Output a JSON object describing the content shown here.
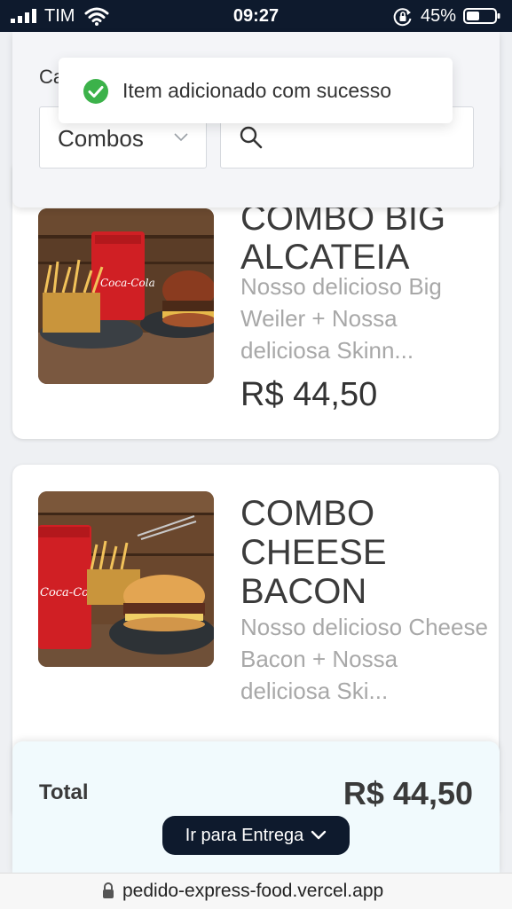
{
  "status_bar": {
    "carrier": "TIM",
    "time": "09:27",
    "battery": "45%",
    "icons": [
      "signal-icon",
      "wifi-icon",
      "orientation-lock-icon",
      "battery-icon"
    ]
  },
  "filter": {
    "label": "Ca",
    "category_value": "Combos",
    "search_value": ""
  },
  "toast": {
    "message": "Item adicionado com sucesso",
    "icon": "check-circle-icon",
    "color": "#3cb24a"
  },
  "products": [
    {
      "name": "COMBO BIG ALCATEIA",
      "description": "Nosso delicioso Big Weiler + Nossa deliciosa Skinn...",
      "price": "R$ 44,50"
    },
    {
      "name": "COMBO CHEESE BACON",
      "description": "Nosso delicioso Cheese Bacon + Nossa deliciosa Ski...",
      "price": ""
    }
  ],
  "cart": {
    "total_label": "Total",
    "total_value": "R$ 44,50",
    "checkout_label": "Ir para Entrega"
  },
  "browser": {
    "url": "pedido-express-food.vercel.app"
  },
  "colors": {
    "dark_navy": "#0e1a2d",
    "success_green": "#3cb24a",
    "footer_bg": "#f1fafd"
  }
}
